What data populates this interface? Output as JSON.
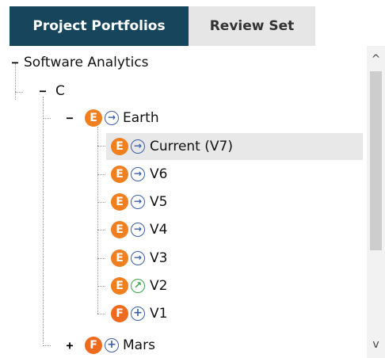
{
  "tabs": [
    {
      "label": "Project Portfolios",
      "active": true
    },
    {
      "label": "Review Set",
      "active": false
    }
  ],
  "tree": {
    "root": {
      "label": "Software Analytics",
      "toggle": "−"
    },
    "folder": {
      "label": "C",
      "toggle": "−"
    },
    "project_earth": {
      "label": "Earth",
      "toggle": "−",
      "badge": "E",
      "status": "arrow-right"
    },
    "versions": [
      {
        "label": "Current (V7)",
        "badge": "E",
        "status": "arrow-right",
        "selected": true
      },
      {
        "label": "V6",
        "badge": "E",
        "status": "arrow-right"
      },
      {
        "label": "V5",
        "badge": "E",
        "status": "arrow-right"
      },
      {
        "label": "V4",
        "badge": "E",
        "status": "arrow-right"
      },
      {
        "label": "V3",
        "badge": "E",
        "status": "arrow-right"
      },
      {
        "label": "V2",
        "badge": "E",
        "status": "arrow-up-right"
      },
      {
        "label": "V1",
        "badge": "F",
        "status": "plus"
      }
    ],
    "project_mars": {
      "label": "Mars",
      "toggle": "+",
      "badge": "F",
      "status": "plus"
    }
  },
  "icons": {
    "arrow_right": "→",
    "arrow_up_right": "↗",
    "plus": "+",
    "scroll_up": "^",
    "scroll_down": "v"
  },
  "colors": {
    "tab_active_bg": "#17465c",
    "badge_e": "#f07f1f",
    "badge_f": "#ee6a1e",
    "status_blue": "#3a5ea6",
    "status_green": "#3aa34a",
    "selection_bg": "#e8e8e8"
  }
}
